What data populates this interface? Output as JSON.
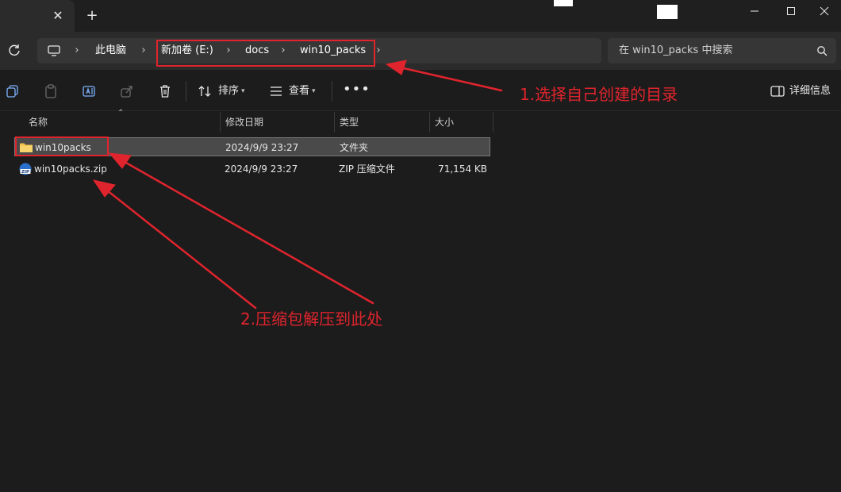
{
  "tabbar": {
    "close_glyph": "✕",
    "new_tab_glyph": "+"
  },
  "breadcrumb": {
    "items": [
      "此电脑",
      "新加卷 (E:)",
      "docs",
      "win10_packs"
    ]
  },
  "search": {
    "placeholder": "在 win10_packs 中搜索"
  },
  "commandbar": {
    "sort_label": "排序",
    "view_label": "查看",
    "more_glyph": "•••",
    "details_label": "详细信息"
  },
  "filelist": {
    "columns": [
      "名称",
      "修改日期",
      "类型",
      "大小"
    ],
    "rows": [
      {
        "name": "win10packs",
        "modified": "2024/9/9 23:27",
        "type": "文件夹",
        "size": "",
        "icon": "folder-icon"
      },
      {
        "name": "win10packs.zip",
        "modified": "2024/9/9 23:27",
        "type": "ZIP 压缩文件",
        "size": "71,154 KB",
        "icon": "zip-icon"
      }
    ]
  },
  "annotations": {
    "note1": "1.选择自己创建的目录",
    "note2": "2.压缩包解压到此处"
  },
  "colors": {
    "background": "#1c1c1c",
    "annotation": "#e0242d",
    "folder": "#f2c04a"
  }
}
